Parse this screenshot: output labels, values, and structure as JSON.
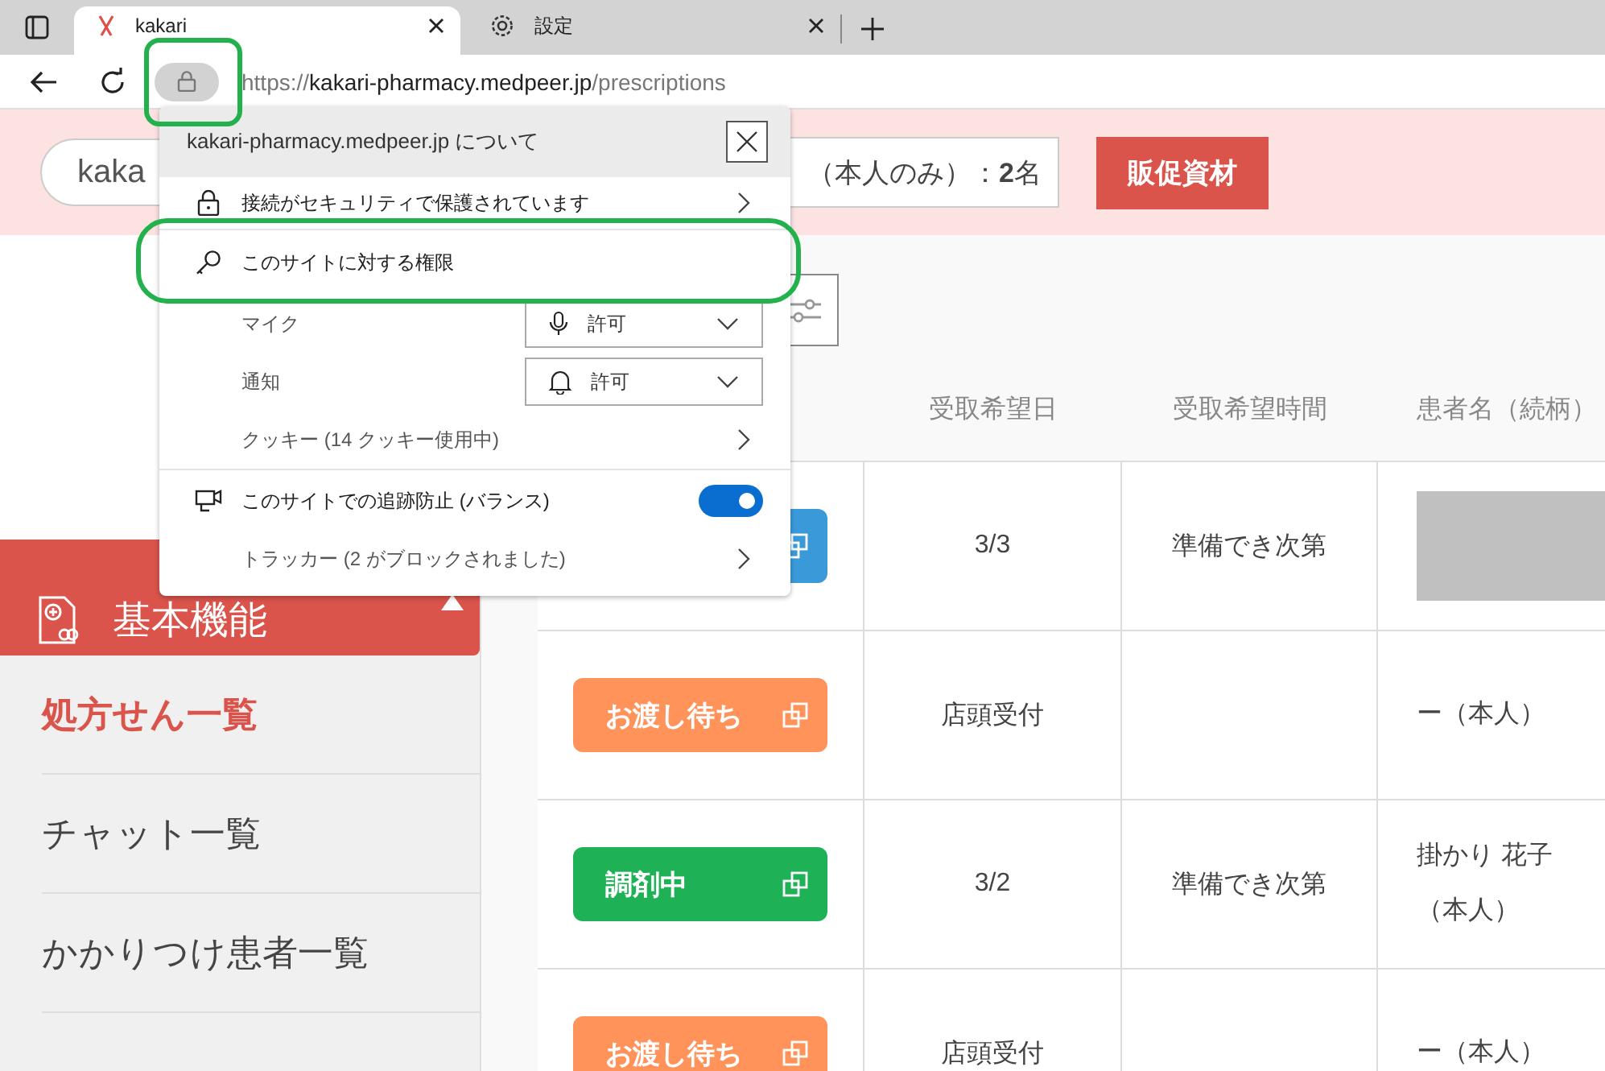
{
  "browser": {
    "tabs": [
      {
        "title": "kakari",
        "selected": true
      },
      {
        "title": "設定",
        "selected": false
      }
    ],
    "url": {
      "scheme": "https://",
      "host": "kakari-pharmacy.medpeer.jp",
      "path": "/prescriptions"
    }
  },
  "header": {
    "search_value": "kaka",
    "count_text": "（本人のみ）：**2**名",
    "button": "販促資材"
  },
  "sidebar": {
    "section": {
      "label": "基本機能",
      "expanded": true
    },
    "items": [
      {
        "label": "処方せん一覧",
        "selected": true
      },
      {
        "label": "チャット一覧",
        "selected": false
      },
      {
        "label": "かかりつけ患者一覧",
        "selected": false
      }
    ]
  },
  "table": {
    "columns": [
      "受取希望日",
      "受取希望時間",
      "患者名（続柄）"
    ],
    "rows": [
      {
        "status": {
          "color": "#3a9ad9"
        },
        "date": "3/3",
        "time": "準備でき次第",
        "patient": {
          "kind": "redacted"
        }
      },
      {
        "status": {
          "color": "#ff9359",
          "label": "お渡し待ち"
        },
        "date": "店頭受付",
        "patient": {
          "kind": "text",
          "text": "ー（本人）"
        }
      },
      {
        "status": {
          "color": "#1fb155",
          "label": "調剤中"
        },
        "date": "3/2",
        "time": "準備でき次第",
        "patient": {
          "kind": "text",
          "text": "掛かり 花子（本人）"
        }
      },
      {
        "status": {
          "color": "#ff9359",
          "label": "お渡し待ち"
        },
        "date": "店頭受付",
        "patient": {
          "kind": "text",
          "text": "ー（本人）"
        }
      }
    ]
  },
  "popup": {
    "title": "kakari-pharmacy.medpeer.jp について",
    "rows": [
      {
        "kind": "secure",
        "label": "接続がセキュリティで保護されています"
      },
      {
        "kind": "permissions",
        "label": "このサイトに対する権限"
      },
      {
        "kind": "microphone",
        "label": "マイク",
        "value": "許可"
      },
      {
        "kind": "notifications",
        "label": "通知",
        "value": "許可"
      },
      {
        "kind": "cookies",
        "label": "クッキー (14 クッキー使用中)"
      },
      {
        "kind": "tracking",
        "label": "このサイトでの追跡防止 (バランス)",
        "on": true
      },
      {
        "kind": "trackers",
        "label": "トラッカー (2 がブロックされました)"
      }
    ]
  }
}
